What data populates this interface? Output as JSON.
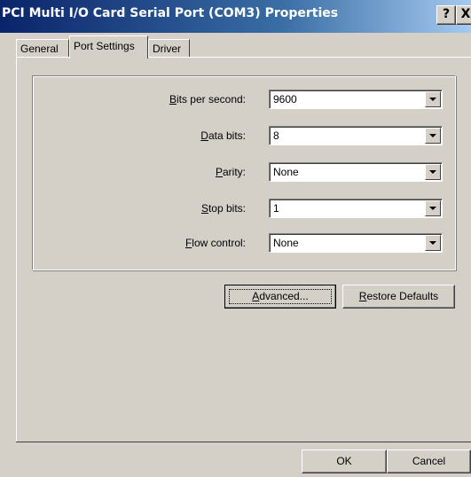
{
  "window": {
    "title": "PCI Multi I/O Card Serial Port (COM3) Properties",
    "help_glyph": "?",
    "close_glyph": "X"
  },
  "tabs": [
    {
      "label": "General"
    },
    {
      "label": "Port Settings",
      "selected": true
    },
    {
      "label": "Driver"
    }
  ],
  "settings": {
    "bits_per_second": {
      "label_pre": "",
      "label_key": "B",
      "label_post": "its per second:",
      "value": "9600"
    },
    "data_bits": {
      "label_pre": "",
      "label_key": "D",
      "label_post": "ata bits:",
      "value": "8"
    },
    "parity": {
      "label_pre": "",
      "label_key": "P",
      "label_post": "arity:",
      "value": "None"
    },
    "stop_bits": {
      "label_pre": "",
      "label_key": "S",
      "label_post": "top bits:",
      "value": "1"
    },
    "flow_control": {
      "label_pre": "",
      "label_key": "F",
      "label_post": "low control:",
      "value": "None"
    }
  },
  "buttons": {
    "advanced": {
      "pre": "",
      "key": "A",
      "post": "dvanced..."
    },
    "restore": {
      "pre": "",
      "key": "R",
      "post": "estore Defaults"
    },
    "ok": "OK",
    "cancel": "Cancel"
  },
  "colors": {
    "face": "#d4d0c8",
    "title_start": "#0a246a",
    "title_end": "#a6caf0"
  }
}
